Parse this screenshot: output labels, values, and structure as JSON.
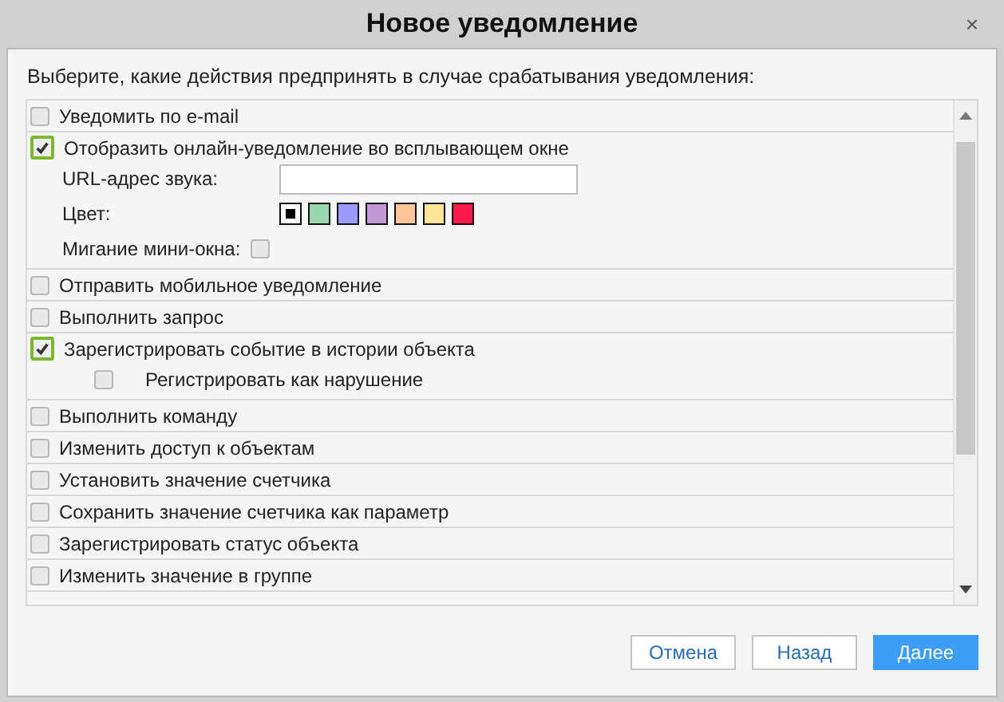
{
  "window": {
    "title": "Новое уведомление",
    "close": "×"
  },
  "prompt": "Выберите, какие действия предпринять в случае срабатывания уведомления:",
  "actions": [
    {
      "label": "Уведомить по e-mail",
      "checked": false
    },
    {
      "label": "Отобразить онлайн-уведомление во всплывающем окне",
      "checked": true,
      "options": [
        {
          "kind": "text",
          "label": "URL-адрес звука:"
        },
        {
          "kind": "colors",
          "label": "Цвет:",
          "swatches": [
            {
              "color": "#000000",
              "selected": true
            },
            {
              "color": "#99d5ad",
              "selected": false
            },
            {
              "color": "#9999ff",
              "selected": false
            },
            {
              "color": "#c299d6",
              "selected": false
            },
            {
              "color": "#ffc299",
              "selected": false
            },
            {
              "color": "#ffe699",
              "selected": false
            },
            {
              "color": "#ff1a4d",
              "selected": false
            }
          ]
        },
        {
          "kind": "check",
          "label": "Мигание мини-окна:",
          "checked": false
        }
      ]
    },
    {
      "label": "Отправить мобильное уведомление",
      "checked": false
    },
    {
      "label": "Выполнить запрос",
      "checked": false
    },
    {
      "label": "Зарегистрировать событие в истории объекта",
      "checked": true,
      "options": [
        {
          "kind": "subcheck",
          "label": "Регистрировать как нарушение",
          "checked": false
        }
      ]
    },
    {
      "label": "Выполнить команду",
      "checked": false
    },
    {
      "label": "Изменить доступ к объектам",
      "checked": false
    },
    {
      "label": "Установить значение счетчика",
      "checked": false
    },
    {
      "label": "Сохранить значение счетчика как параметр",
      "checked": false
    },
    {
      "label": "Зарегистрировать статус объекта",
      "checked": false
    },
    {
      "label": "Изменить значение в группе",
      "checked": false
    }
  ],
  "buttons": [
    {
      "label": "Отмена",
      "kind": "secondary"
    },
    {
      "label": "Назад",
      "kind": "secondary"
    },
    {
      "label": "Далее",
      "kind": "primary"
    }
  ]
}
